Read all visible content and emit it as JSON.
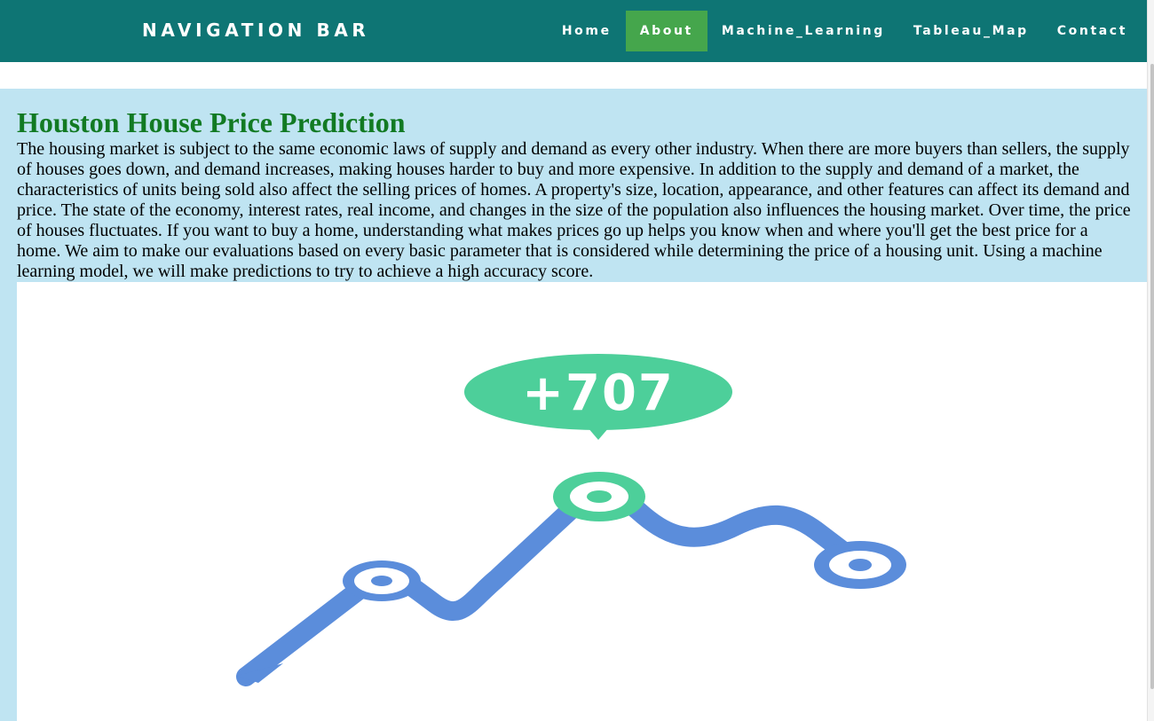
{
  "navbar": {
    "brand": "NAVIGATION BAR",
    "links": [
      {
        "label": "Home",
        "active": false
      },
      {
        "label": "About",
        "active": true
      },
      {
        "label": "Machine_Learning",
        "active": false
      },
      {
        "label": "Tableau_Map",
        "active": false
      },
      {
        "label": "Contact",
        "active": false
      }
    ],
    "colors": {
      "background": "#0e7574",
      "active": "#45a64c"
    }
  },
  "main": {
    "title": "Houston House Price Prediction",
    "intro": "The housing market is subject to the same economic laws of supply and demand as every other industry. When there are more buyers than sellers, the supply of houses goes down, and demand increases, making houses harder to buy and more expensive. In addition to the supply and demand of a market, the characteristics of units being sold also affect the selling prices of homes. A property's size, location, appearance, and other features can affect its demand and price. The state of the economy, interest rates, real income, and changes in the size of the population also influences the housing market. Over time, the price of houses fluctuates. If you want to buy a home, understanding what makes prices go up helps you know when and where you'll get the best price for a home. We aim to make our evaluations based on every basic parameter that is considered while determining the price of a housing unit. Using a machine learning model, we will make predictions to try to achieve a high accuracy score.",
    "colors": {
      "background": "#bfe4f2",
      "title": "#127a23"
    },
    "illustration": {
      "badge_text": "+707",
      "colors": {
        "line": "#5b8ddb",
        "badge": "#4dcf9a"
      }
    }
  }
}
